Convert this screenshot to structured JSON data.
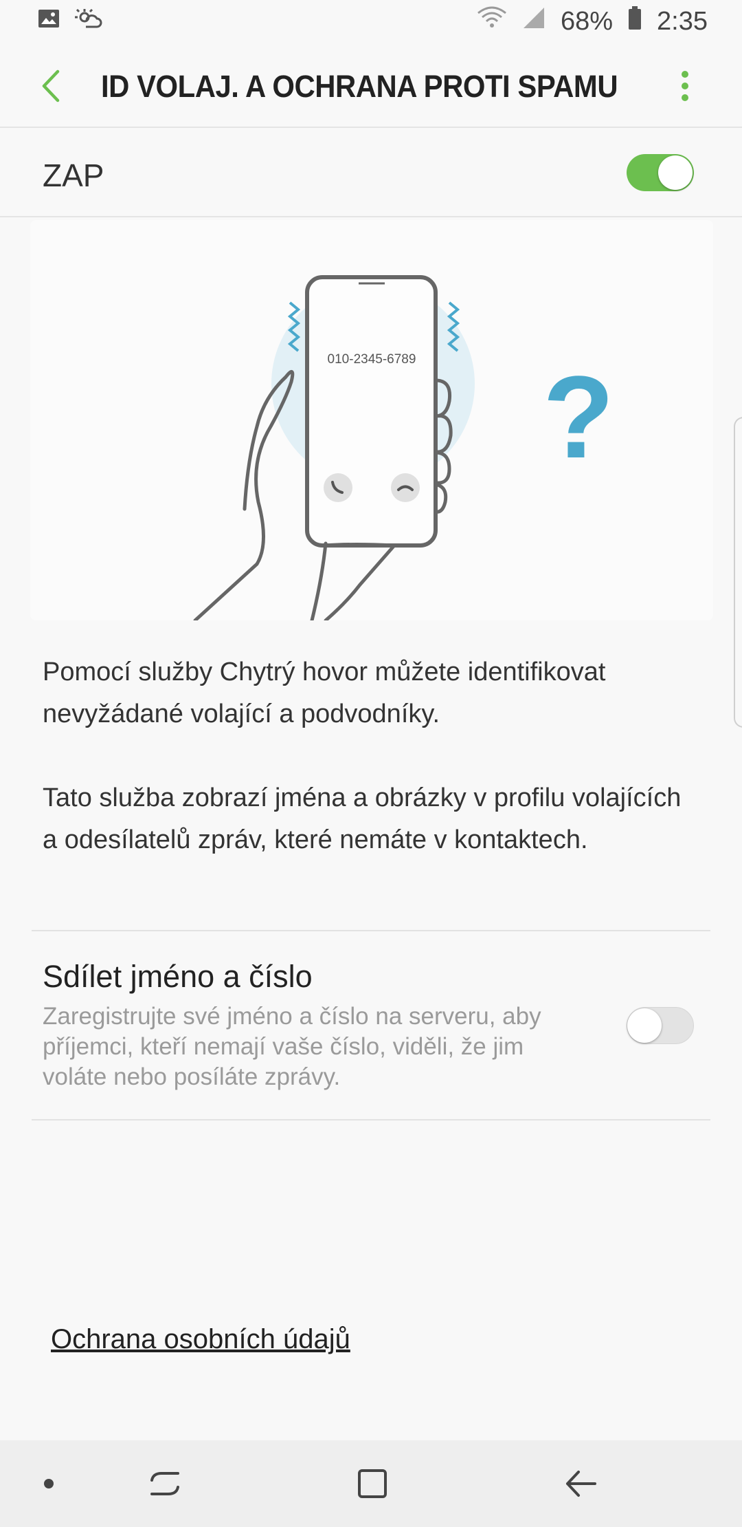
{
  "status_bar": {
    "battery": "68%",
    "time": "2:35",
    "left_icons": [
      "gallery-icon",
      "weather-icon"
    ],
    "right_icons": [
      "wifi-icon",
      "signal-icon",
      "battery-icon"
    ]
  },
  "app_bar": {
    "title": "ID VOLAJ. A OCHRANA PROTI SPAMU",
    "back_icon": "chevron-left-icon",
    "more_icon": "more-vertical-icon"
  },
  "master_switch": {
    "label": "ZAP",
    "on": true
  },
  "illustration": {
    "phone_number": "010-2345-6789",
    "question_mark": "?"
  },
  "description": {
    "p1": "Pomocí služby Chytrý hovor můžete identifikovat nevyžádané volající a podvodníky.",
    "p2": "Tato služba zobrazí jména a obrázky v profilu volajících a odesílatelů zpráv, které nemáte v kontaktech."
  },
  "share_setting": {
    "title": "Sdílet jméno a číslo",
    "description": "Zaregistrujte své jméno a číslo na serveru, aby příjemci, kteří nemají vaše číslo, viděli, že jim voláte nebo posíláte zprávy.",
    "on": false
  },
  "privacy_link": "Ochrana osobních údajů",
  "nav_bar": {
    "items": [
      "dot-icon",
      "recents-icon",
      "home-icon",
      "back-icon"
    ]
  },
  "colors": {
    "accent_green": "#6cbf4f",
    "illustration_blue": "#4aa8cc"
  }
}
